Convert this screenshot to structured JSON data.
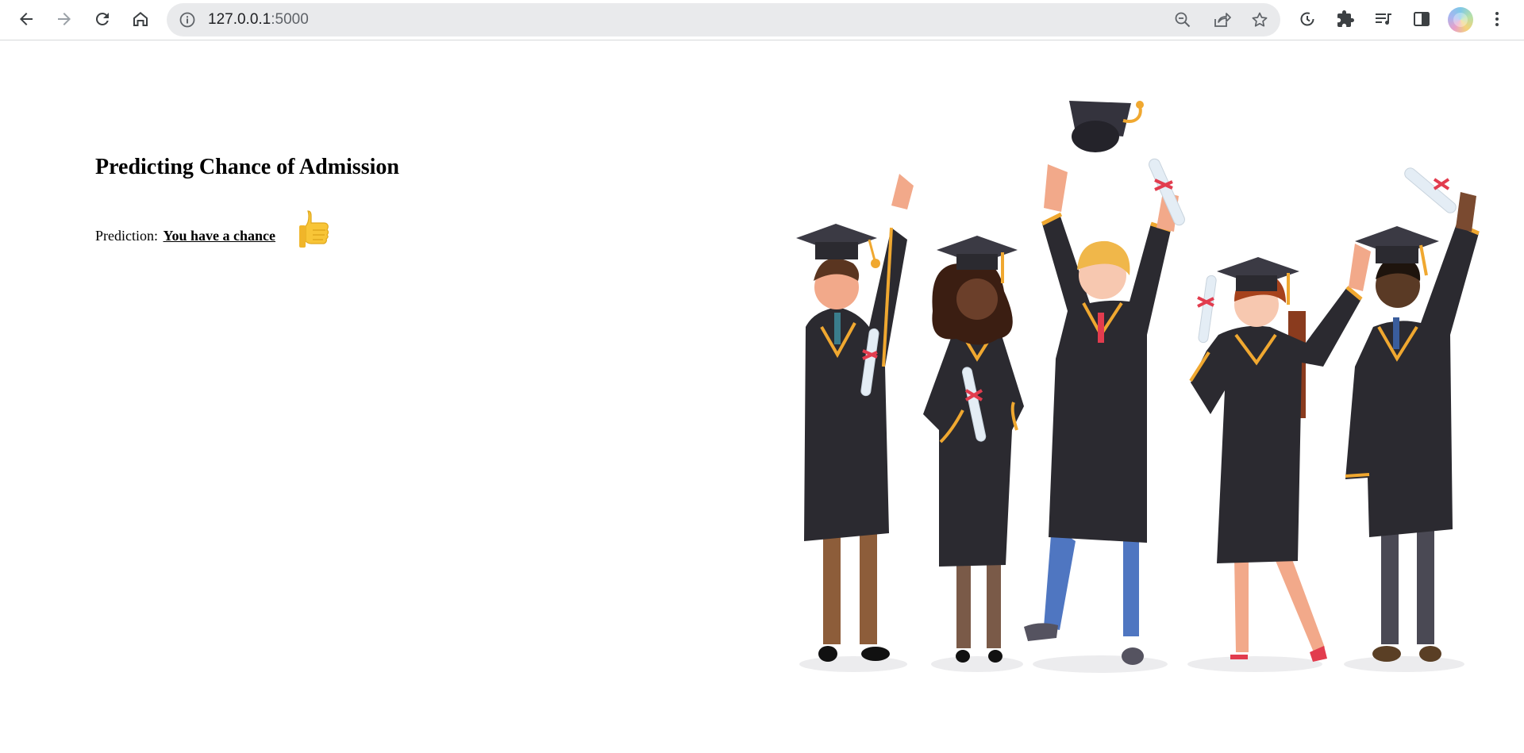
{
  "browser": {
    "url_host": "127.0.0.1",
    "url_port": ":5000",
    "nav": {
      "back": "arrow-left-icon",
      "forward": "arrow-right-icon",
      "reload": "reload-icon",
      "home": "home-icon"
    },
    "omnibox_icons": [
      "info-icon",
      "zoom-out-icon",
      "share-icon",
      "star-icon"
    ],
    "extension_icons": [
      "history-sync-icon",
      "puzzle-icon",
      "media-queue-icon",
      "side-panel-icon",
      "profile-avatar",
      "more-vert-icon"
    ]
  },
  "page": {
    "title": "Predicting Chance of Admission",
    "prediction_label": "Prediction:",
    "prediction_result": "You have a chance",
    "result_icon": "thumbs-up-icon",
    "hero_image": "graduates-illustration"
  },
  "colors": {
    "gown": "#2b2a30",
    "gold_trim": "#f0a830",
    "thumb": "#f8c537",
    "omnibox_bg": "#e9eaec"
  }
}
